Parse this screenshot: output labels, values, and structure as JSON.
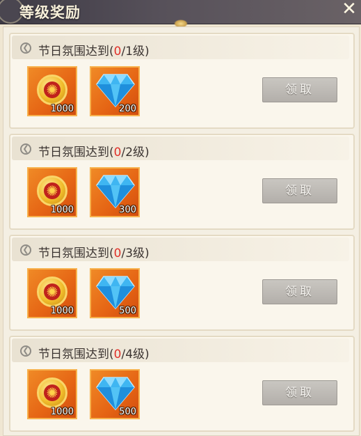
{
  "title": "等级奖励",
  "close_icon": "close-x-icon",
  "tiers": [
    {
      "prefix": "节日氛围达到(",
      "current": "0",
      "target": "/1级)",
      "rewards": [
        {
          "icon": "firework-coin-icon",
          "qty": "1000"
        },
        {
          "icon": "blue-diamond-icon",
          "qty": "200"
        }
      ],
      "button": "领取"
    },
    {
      "prefix": "节日氛围达到(",
      "current": "0",
      "target": "/2级)",
      "rewards": [
        {
          "icon": "firework-coin-icon",
          "qty": "1000"
        },
        {
          "icon": "blue-diamond-icon",
          "qty": "300"
        }
      ],
      "button": "领取"
    },
    {
      "prefix": "节日氛围达到(",
      "current": "0",
      "target": "/3级)",
      "rewards": [
        {
          "icon": "firework-coin-icon",
          "qty": "1000"
        },
        {
          "icon": "blue-diamond-icon",
          "qty": "500"
        }
      ],
      "button": "领取"
    },
    {
      "prefix": "节日氛围达到(",
      "current": "0",
      "target": "/4级)",
      "rewards": [
        {
          "icon": "firework-coin-icon",
          "qty": "1000"
        },
        {
          "icon": "blue-diamond-icon",
          "qty": "500"
        }
      ],
      "button": "领取"
    }
  ],
  "colors": {
    "progress_current": "#e0312a",
    "item_frame": "#e56414",
    "button_disabled": "#b9b5b0"
  }
}
